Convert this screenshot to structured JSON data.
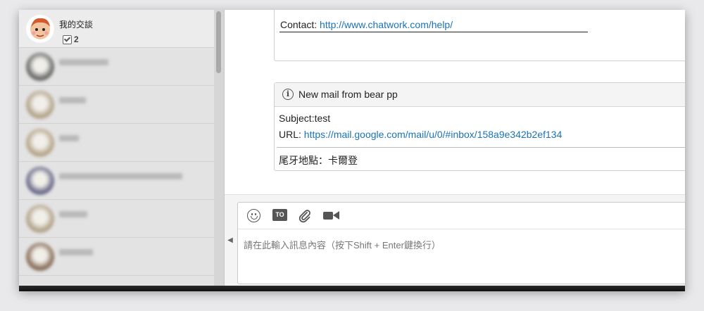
{
  "sidebar": {
    "active_room": {
      "name": "我的交談",
      "task_count": "2"
    },
    "rooms": [
      {
        "avatar_color": "#6b6b6b",
        "name_width": 70
      },
      {
        "avatar_color": "#b3a48a",
        "name_width": 38
      },
      {
        "avatar_color": "#b5a589",
        "name_width": 28
      },
      {
        "avatar_color": "#6a6b8a",
        "name_width": 175
      },
      {
        "avatar_color": "#b2a38a",
        "name_width": 40
      },
      {
        "avatar_color": "#8a6f5a",
        "name_width": 48
      }
    ]
  },
  "messages": {
    "card1": {
      "label": "Contact: ",
      "link": "http://www.chatwork.com/help/"
    },
    "card2": {
      "title": "New mail from bear pp",
      "subject": "Subject:test",
      "url_label": "URL: ",
      "url": "https://mail.google.com/mail/u/0/#inbox/158a9e342b2ef134",
      "location": "尾牙地點：卡爾登"
    }
  },
  "composer": {
    "placeholder": "請在此輸入訊息內容（按下Shift + Enter鍵換行）",
    "tools": [
      "emoji-icon",
      "to-icon",
      "paperclip-icon",
      "video-icon"
    ],
    "to_label": "TO"
  },
  "colors": {
    "link": "#1a73b8",
    "sidebar_bg": "#e3e3e3"
  }
}
